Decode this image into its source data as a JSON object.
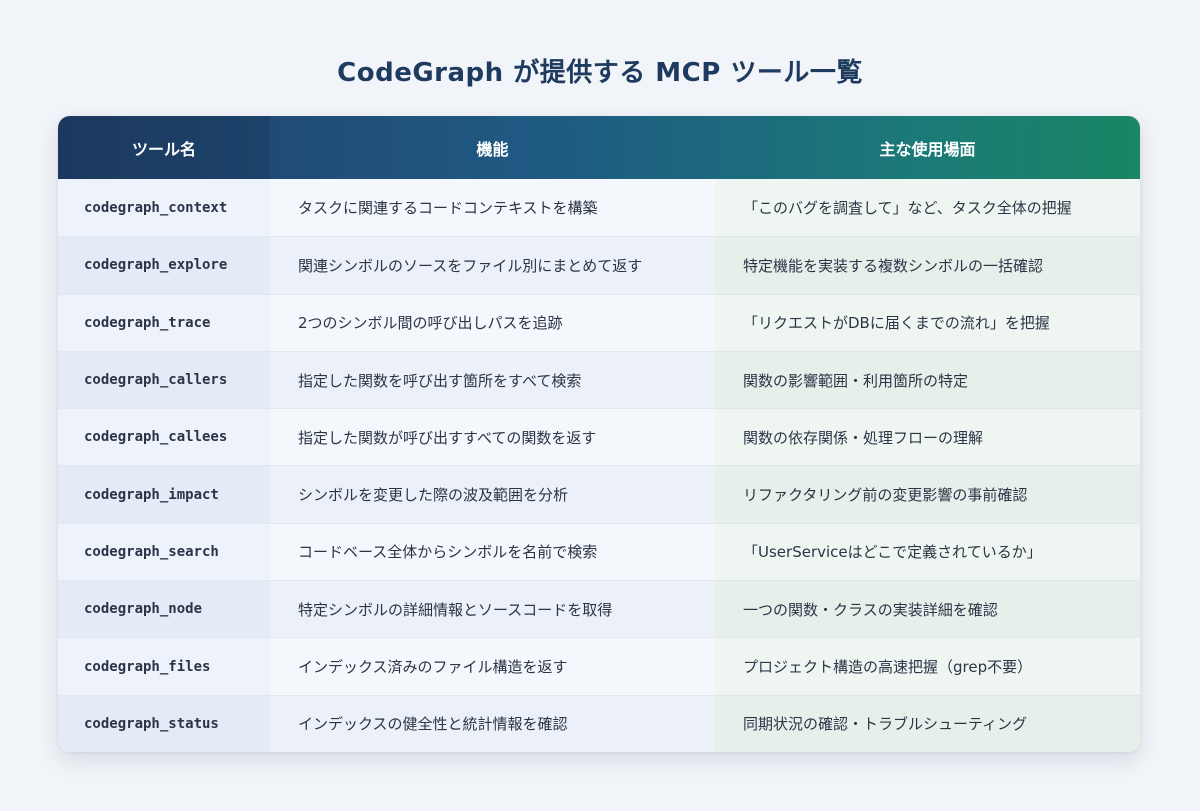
{
  "title": "CodeGraph が提供する MCP ツール一覧",
  "table": {
    "headers": [
      "ツール名",
      "機能",
      "主な使用場面"
    ],
    "rows": [
      [
        "codegraph_context",
        "タスクに関連するコードコンテキストを構築",
        "「このバグを調査して」など、タスク全体の把握"
      ],
      [
        "codegraph_explore",
        "関連シンボルのソースをファイル別にまとめて返す",
        "特定機能を実装する複数シンボルの一括確認"
      ],
      [
        "codegraph_trace",
        "2つのシンボル間の呼び出しパスを追跡",
        "「リクエストがDBに届くまでの流れ」を把握"
      ],
      [
        "codegraph_callers",
        "指定した関数を呼び出す箇所をすべて検索",
        "関数の影響範囲・利用箇所の特定"
      ],
      [
        "codegraph_callees",
        "指定した関数が呼び出すすべての関数を返す",
        "関数の依存関係・処理フローの理解"
      ],
      [
        "codegraph_impact",
        "シンボルを変更した際の波及範囲を分析",
        "リファクタリング前の変更影響の事前確認"
      ],
      [
        "codegraph_search",
        "コードベース全体からシンボルを名前で検索",
        "「UserServiceはどこで定義されているか」"
      ],
      [
        "codegraph_node",
        "特定シンボルの詳細情報とソースコードを取得",
        "一つの関数・クラスの実装詳細を確認"
      ],
      [
        "codegraph_files",
        "インデックス済みのファイル構造を返す",
        "プロジェクト構造の高速把握（grep不要）"
      ],
      [
        "codegraph_status",
        "インデックスの健全性と統計情報を確認",
        "同期状況の確認・トラブルシューティング"
      ]
    ]
  },
  "colors": {
    "title": "#1f3a5f",
    "header_start": "#213f6b",
    "header_end": "#1a8663"
  }
}
